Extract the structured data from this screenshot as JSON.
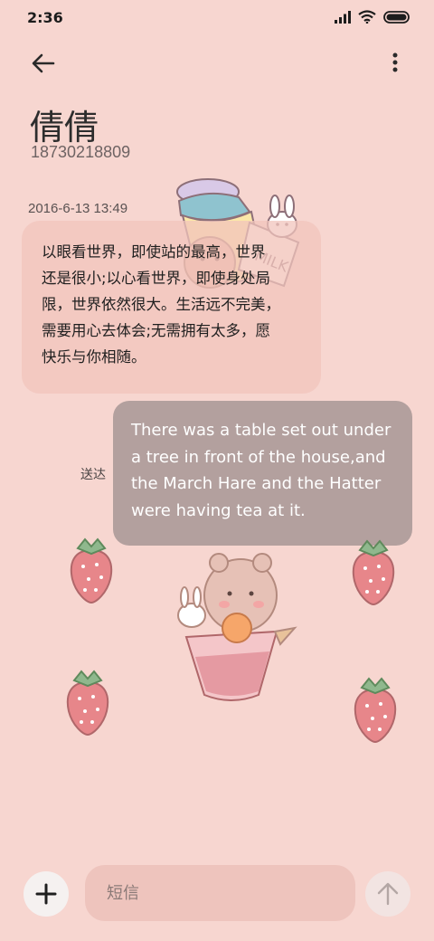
{
  "status_bar": {
    "time": "2:36",
    "icons": [
      "signal-icon",
      "wifi-icon",
      "battery-icon"
    ]
  },
  "header": {
    "back_icon": "arrow-left-icon",
    "more_icon": "more-vertical-icon",
    "contact_name": "倩倩",
    "contact_number": "18730218809"
  },
  "conversation": {
    "timestamp": "2016-6-13 13:49",
    "messages": [
      {
        "direction": "incoming",
        "lines": [
          "以眼看世界，即使站的最高，世界",
          "还是很小;以心看世界，即使身处局",
          "限，世界依然很大。生活远不完美，",
          "需要用心去体会;无需拥有太多，愿",
          "快乐与你相随。"
        ]
      },
      {
        "direction": "outgoing",
        "status": "送达",
        "lines": [
          "There was a table set out under",
          "a tree in front of the house,and",
          "the March Hare and the Hatter",
          "were having tea at it."
        ]
      }
    ]
  },
  "composer": {
    "add_icon": "plus-icon",
    "placeholder": "短信",
    "send_icon": "arrow-up-icon"
  },
  "theme": {
    "background": "#f7d6d0",
    "incoming_bubble": "#f1c4bc",
    "outgoing_bubble": "#b3a09e",
    "input_background": "#eec4bd",
    "strawberry": "#e7868a"
  },
  "decorations": [
    "honey-jar-sticker",
    "bunny-icon",
    "bear-icon",
    "strawberry-icon"
  ]
}
